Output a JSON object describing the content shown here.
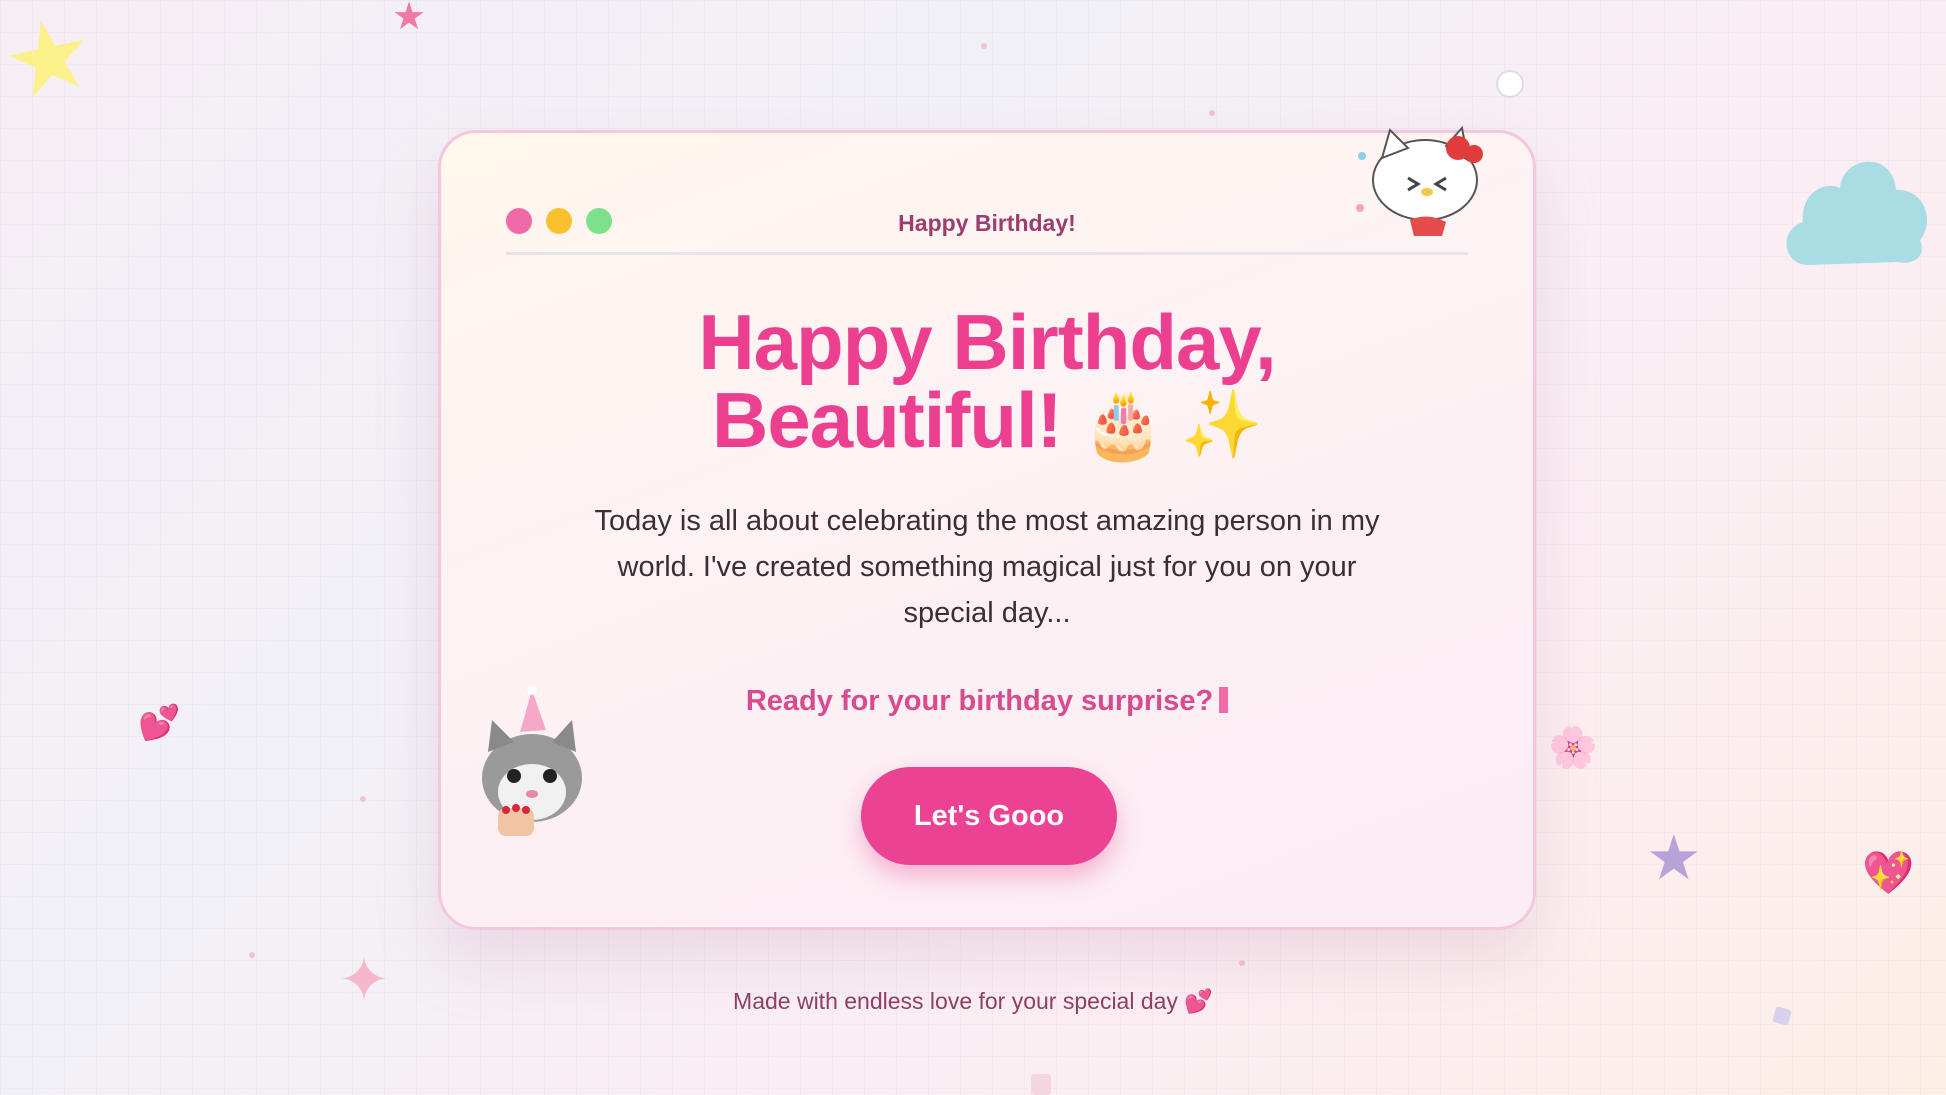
{
  "window": {
    "title": "Happy Birthday!"
  },
  "heading": {
    "line1": "Happy Birthday,",
    "line2": "Beautiful!",
    "emoji": "🎂 ✨"
  },
  "description": "Today is all about celebrating the most amazing person in my world. I've created something magical just for you on your special day...",
  "prompt": "Ready for your birthday surprise?",
  "button": {
    "label": "Let's Gooo"
  },
  "footer": "Made with endless love for your special day 💕",
  "decorations": {
    "star_yellow": "★",
    "star_pink": "★",
    "star_purple": "★",
    "hearts_left": "💕",
    "flower": "🌸",
    "heart_sparkle": "💖",
    "sparkle": "✦",
    "cake": "🎂"
  },
  "colors": {
    "accent": "#ec4293",
    "heading": "#ec3f90",
    "titlebar_red": "#f06aa7",
    "titlebar_yellow": "#fbc02d",
    "titlebar_green": "#7ee08b",
    "cloud": "#a9dce3"
  }
}
